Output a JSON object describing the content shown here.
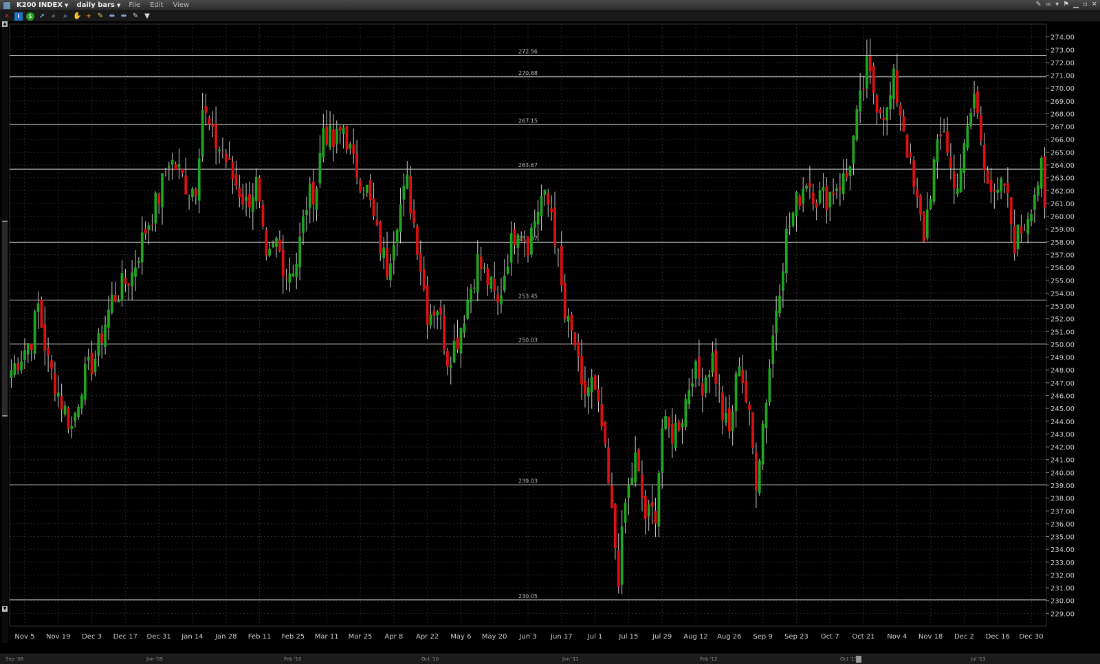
{
  "window": {
    "symbol": "K200 INDEX",
    "bar_type": "daily bars",
    "menus": [
      "File",
      "Edit",
      "View"
    ]
  },
  "toolbar": {
    "icons": [
      "info-icon",
      "dollar-icon",
      "arrow-cursor-icon",
      "zoom-in-icon",
      "zoom-out-icon",
      "hand-icon",
      "crosshair-icon",
      "draw-icon",
      "fit-icon",
      "fit-range-icon",
      "wrench-icon",
      "dropdown-icon"
    ]
  },
  "colors": {
    "up": "#1fa81f",
    "down": "#e01010",
    "background": "#000000",
    "grid": "#2a2a2a",
    "level_line": "#d8d8d8"
  },
  "chart_data": {
    "type": "candlestick",
    "title": "",
    "ylim": [
      228.0,
      275.0
    ],
    "y_ticks": [
      "229.00",
      "230.00",
      "231.00",
      "232.00",
      "233.00",
      "234.00",
      "235.00",
      "236.00",
      "237.00",
      "238.00",
      "239.00",
      "240.00",
      "241.00",
      "242.00",
      "243.00",
      "244.00",
      "245.00",
      "246.00",
      "247.00",
      "248.00",
      "249.00",
      "250.00",
      "251.00",
      "252.00",
      "253.00",
      "254.00",
      "255.00",
      "256.00",
      "257.00",
      "258.00",
      "259.00",
      "260.00",
      "261.00",
      "262.00",
      "263.00",
      "264.00",
      "265.00",
      "266.00",
      "267.00",
      "268.00",
      "269.00",
      "270.00",
      "271.00",
      "272.00",
      "273.00",
      "274.00"
    ],
    "x_ticks": [
      "Nov 5",
      "Nov 19",
      "Dec 3",
      "Dec 17",
      "Dec 31",
      "Jan 14",
      "Jan 28",
      "Feb 11",
      "Feb 25",
      "Mar 11",
      "Mar 25",
      "Apr 8",
      "Apr 22",
      "May 6",
      "May 20",
      "Jun 3",
      "Jun 17",
      "Jul 1",
      "Jul 15",
      "Jul 29",
      "Aug 12",
      "Aug 26",
      "Sep 9",
      "Sep 23",
      "Oct 7",
      "Oct 21",
      "Nov 4",
      "Nov 18",
      "Dec 2",
      "Dec 16",
      "Dec 30"
    ],
    "levels": [
      {
        "value": 272.56,
        "label": "272.56"
      },
      {
        "value": 270.88,
        "label": "270.88"
      },
      {
        "value": 267.15,
        "label": "267.15"
      },
      {
        "value": 263.67,
        "label": "263.67"
      },
      {
        "value": 257.97,
        "label": "257.97"
      },
      {
        "value": 253.45,
        "label": "253.45"
      },
      {
        "value": 250.03,
        "label": "250.03"
      },
      {
        "value": 239.03,
        "label": "239.03"
      },
      {
        "value": 230.05,
        "label": "230.05"
      }
    ],
    "anchors": [
      [
        0,
        248.0
      ],
      [
        6,
        250.5
      ],
      [
        8,
        253.0
      ],
      [
        11,
        248.5
      ],
      [
        15,
        245.5
      ],
      [
        18,
        243.5
      ],
      [
        21,
        247.0
      ],
      [
        25,
        249.0
      ],
      [
        30,
        253.5
      ],
      [
        36,
        255.5
      ],
      [
        40,
        259.0
      ],
      [
        44,
        261.5
      ],
      [
        47,
        264.5
      ],
      [
        50,
        263.5
      ],
      [
        53,
        262.0
      ],
      [
        55,
        262.5
      ],
      [
        57,
        268.5
      ],
      [
        60,
        266.0
      ],
      [
        63,
        265.0
      ],
      [
        66,
        263.0
      ],
      [
        70,
        261.0
      ],
      [
        73,
        262.5
      ],
      [
        76,
        256.0
      ],
      [
        79,
        258.0
      ],
      [
        82,
        255.5
      ],
      [
        85,
        256.5
      ],
      [
        88,
        261.0
      ],
      [
        91,
        262.5
      ],
      [
        93,
        267.0
      ],
      [
        96,
        265.5
      ],
      [
        99,
        267.0
      ],
      [
        102,
        264.0
      ],
      [
        106,
        262.0
      ],
      [
        109,
        258.5
      ],
      [
        112,
        256.0
      ],
      [
        115,
        260.0
      ],
      [
        118,
        262.5
      ],
      [
        121,
        258.0
      ],
      [
        124,
        252.5
      ],
      [
        127,
        253.0
      ],
      [
        130,
        249.0
      ],
      [
        133,
        250.5
      ],
      [
        136,
        253.5
      ],
      [
        139,
        256.5
      ],
      [
        142,
        255.0
      ],
      [
        145,
        253.0
      ],
      [
        148,
        257.0
      ],
      [
        151,
        259.5
      ],
      [
        154,
        258.0
      ],
      [
        158,
        261.5
      ],
      [
        161,
        260.5
      ],
      [
        163,
        256.5
      ],
      [
        165,
        252.0
      ],
      [
        168,
        250.0
      ],
      [
        170,
        246.0
      ],
      [
        173,
        247.0
      ],
      [
        176,
        243.5
      ],
      [
        179,
        236.5
      ],
      [
        181,
        232.0
      ],
      [
        183,
        237.5
      ],
      [
        186,
        241.0
      ],
      [
        189,
        236.5
      ],
      [
        192,
        237.0
      ],
      [
        194,
        243.5
      ],
      [
        197,
        243.0
      ],
      [
        200,
        244.5
      ],
      [
        203,
        248.0
      ],
      [
        206,
        247.0
      ],
      [
        209,
        249.0
      ],
      [
        212,
        244.5
      ],
      [
        214,
        243.0
      ],
      [
        217,
        249.0
      ],
      [
        220,
        244.0
      ],
      [
        222,
        239.5
      ],
      [
        225,
        246.0
      ],
      [
        228,
        253.0
      ],
      [
        231,
        258.5
      ],
      [
        234,
        261.0
      ],
      [
        237,
        263.0
      ],
      [
        240,
        261.5
      ],
      [
        243,
        261.5
      ],
      [
        246,
        262.5
      ],
      [
        249,
        263.0
      ],
      [
        252,
        267.5
      ],
      [
        255,
        271.5
      ],
      [
        258,
        269.0
      ],
      [
        261,
        268.0
      ],
      [
        263,
        270.5
      ],
      [
        266,
        267.0
      ],
      [
        269,
        262.0
      ],
      [
        272,
        258.5
      ],
      [
        275,
        264.0
      ],
      [
        278,
        267.0
      ],
      [
        281,
        262.0
      ],
      [
        284,
        265.0
      ],
      [
        287,
        269.5
      ],
      [
        290,
        264.5
      ],
      [
        293,
        261.0
      ],
      [
        296,
        262.5
      ],
      [
        299,
        258.0
      ],
      [
        302,
        259.5
      ],
      [
        305,
        262.0
      ],
      [
        307,
        263.5
      ],
      [
        308,
        260.0
      ]
    ],
    "num_bars": 309
  },
  "overview": {
    "labels": [
      "Sep '08",
      "Jan '09",
      "Feb '10",
      "Oct '10",
      "Jan '11",
      "Feb '12",
      "Oct '13",
      "Jul '13"
    ]
  }
}
